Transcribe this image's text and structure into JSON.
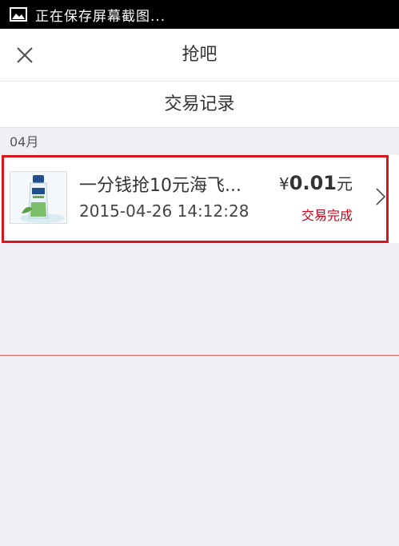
{
  "status_bar": {
    "text": "正在保存屏幕截图..."
  },
  "nav": {
    "title": "抢吧"
  },
  "section": {
    "title": "交易记录"
  },
  "records": [
    {
      "month": "04月",
      "name": "一分钱抢10元海飞...",
      "time": "2015-04-26 14:12:28",
      "currency_symbol": "¥",
      "amount": "0.01",
      "unit": "元",
      "status": "交易完成"
    }
  ],
  "colors": {
    "status_red": "#d0021b",
    "highlight": "#d9151e",
    "divider": "#e06060"
  }
}
